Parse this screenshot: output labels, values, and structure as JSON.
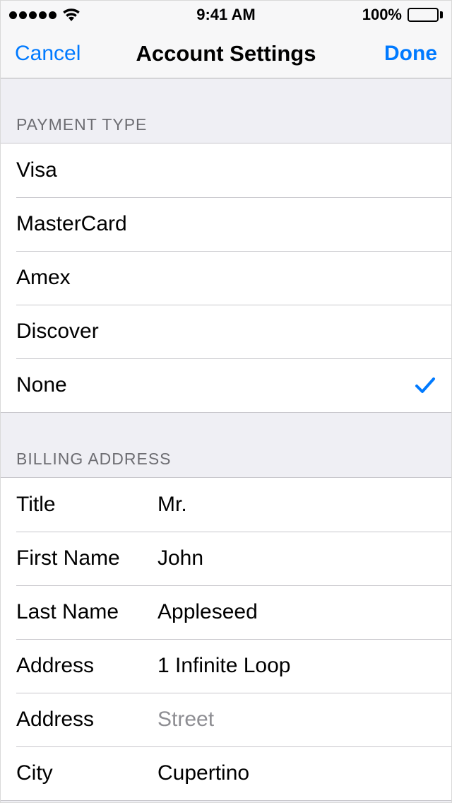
{
  "status": {
    "time": "9:41 AM",
    "battery_pct": "100%"
  },
  "nav": {
    "left": "Cancel",
    "title": "Account Settings",
    "right": "Done"
  },
  "sections": {
    "payment": {
      "header": "PAYMENT TYPE",
      "options": [
        {
          "label": "Visa",
          "selected": false
        },
        {
          "label": "MasterCard",
          "selected": false
        },
        {
          "label": "Amex",
          "selected": false
        },
        {
          "label": "Discover",
          "selected": false
        },
        {
          "label": "None",
          "selected": true
        }
      ]
    },
    "billing": {
      "header": "BILLING ADDRESS",
      "fields": [
        {
          "label": "Title",
          "value": "Mr."
        },
        {
          "label": "First Name",
          "value": "John"
        },
        {
          "label": "Last Name",
          "value": "Appleseed"
        },
        {
          "label": "Address",
          "value": "1 Infinite Loop"
        },
        {
          "label": "Address",
          "value": "",
          "placeholder": "Street"
        },
        {
          "label": "City",
          "value": "Cupertino"
        }
      ]
    }
  },
  "colors": {
    "tint": "#007aff",
    "section_bg": "#efeff4",
    "separator": "#c8c7cc",
    "secondary_text": "#6d6d72",
    "placeholder": "#8e8e93"
  }
}
